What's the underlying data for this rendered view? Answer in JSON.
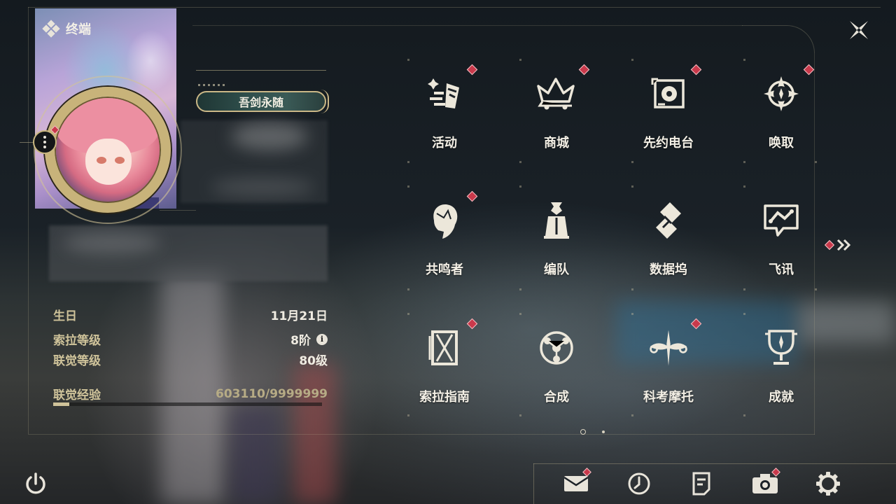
{
  "header": {
    "title": "终端",
    "close_icon": "close-x-icon"
  },
  "profile": {
    "title_badge": "吾剑永随",
    "more_icon": "more-dots-icon"
  },
  "stats": {
    "birthday_label": "生日",
    "birthday_value": "11月21日",
    "sola_level_label": "索拉等级",
    "sola_level_value": "8阶",
    "union_level_label": "联觉等级",
    "union_level_value": "80级",
    "union_exp_label": "联觉经验",
    "union_exp_value": "603110/9999999",
    "union_exp_progress": 0.06
  },
  "menu": {
    "items": [
      {
        "label": "活动",
        "icon": "events-icon",
        "alert": true
      },
      {
        "label": "商城",
        "icon": "shop-icon",
        "alert": true
      },
      {
        "label": "先约电台",
        "icon": "radio-icon",
        "alert": true
      },
      {
        "label": "唤取",
        "icon": "convene-icon",
        "alert": true
      },
      {
        "label": "共鸣者",
        "icon": "resonators-icon",
        "alert": true
      },
      {
        "label": "编队",
        "icon": "team-icon",
        "alert": false
      },
      {
        "label": "数据坞",
        "icon": "data-bank-icon",
        "alert": false
      },
      {
        "label": "飞讯",
        "icon": "messages-icon",
        "alert": false
      },
      {
        "label": "索拉指南",
        "icon": "guidebook-icon",
        "alert": true
      },
      {
        "label": "合成",
        "icon": "synthesis-icon",
        "alert": false
      },
      {
        "label": "科考摩托",
        "icon": "motorbike-icon",
        "alert": true
      },
      {
        "label": "成就",
        "icon": "achievements-icon",
        "alert": false
      }
    ],
    "page_count": 2,
    "current_page": 1
  },
  "bottom_bar": {
    "icons": [
      "power-icon",
      "mail-icon",
      "clock-icon",
      "notice-icon",
      "camera-icon",
      "settings-icon"
    ]
  },
  "colors": {
    "accent_gold": "#cbb887",
    "alert_red": "#c9394b"
  }
}
